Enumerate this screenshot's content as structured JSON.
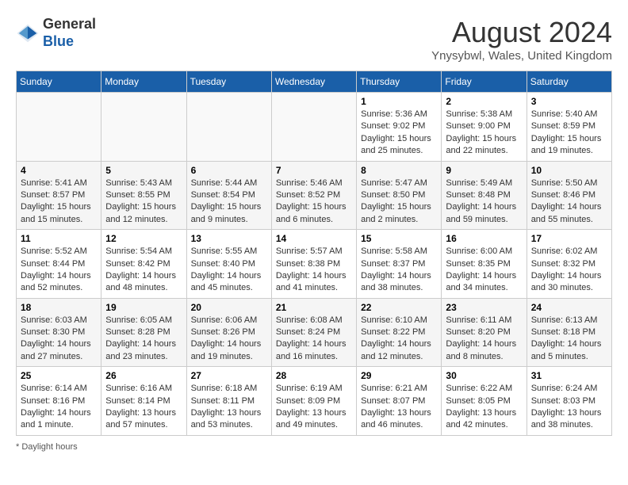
{
  "logo": {
    "text_general": "General",
    "text_blue": "Blue"
  },
  "title": "August 2024",
  "location": "Ynysybwl, Wales, United Kingdom",
  "days_of_week": [
    "Sunday",
    "Monday",
    "Tuesday",
    "Wednesday",
    "Thursday",
    "Friday",
    "Saturday"
  ],
  "footer": "Daylight hours",
  "weeks": [
    [
      {
        "day": "",
        "info": ""
      },
      {
        "day": "",
        "info": ""
      },
      {
        "day": "",
        "info": ""
      },
      {
        "day": "",
        "info": ""
      },
      {
        "day": "1",
        "info": "Sunrise: 5:36 AM\nSunset: 9:02 PM\nDaylight: 15 hours\nand 25 minutes."
      },
      {
        "day": "2",
        "info": "Sunrise: 5:38 AM\nSunset: 9:00 PM\nDaylight: 15 hours\nand 22 minutes."
      },
      {
        "day": "3",
        "info": "Sunrise: 5:40 AM\nSunset: 8:59 PM\nDaylight: 15 hours\nand 19 minutes."
      }
    ],
    [
      {
        "day": "4",
        "info": "Sunrise: 5:41 AM\nSunset: 8:57 PM\nDaylight: 15 hours\nand 15 minutes."
      },
      {
        "day": "5",
        "info": "Sunrise: 5:43 AM\nSunset: 8:55 PM\nDaylight: 15 hours\nand 12 minutes."
      },
      {
        "day": "6",
        "info": "Sunrise: 5:44 AM\nSunset: 8:54 PM\nDaylight: 15 hours\nand 9 minutes."
      },
      {
        "day": "7",
        "info": "Sunrise: 5:46 AM\nSunset: 8:52 PM\nDaylight: 15 hours\nand 6 minutes."
      },
      {
        "day": "8",
        "info": "Sunrise: 5:47 AM\nSunset: 8:50 PM\nDaylight: 15 hours\nand 2 minutes."
      },
      {
        "day": "9",
        "info": "Sunrise: 5:49 AM\nSunset: 8:48 PM\nDaylight: 14 hours\nand 59 minutes."
      },
      {
        "day": "10",
        "info": "Sunrise: 5:50 AM\nSunset: 8:46 PM\nDaylight: 14 hours\nand 55 minutes."
      }
    ],
    [
      {
        "day": "11",
        "info": "Sunrise: 5:52 AM\nSunset: 8:44 PM\nDaylight: 14 hours\nand 52 minutes."
      },
      {
        "day": "12",
        "info": "Sunrise: 5:54 AM\nSunset: 8:42 PM\nDaylight: 14 hours\nand 48 minutes."
      },
      {
        "day": "13",
        "info": "Sunrise: 5:55 AM\nSunset: 8:40 PM\nDaylight: 14 hours\nand 45 minutes."
      },
      {
        "day": "14",
        "info": "Sunrise: 5:57 AM\nSunset: 8:38 PM\nDaylight: 14 hours\nand 41 minutes."
      },
      {
        "day": "15",
        "info": "Sunrise: 5:58 AM\nSunset: 8:37 PM\nDaylight: 14 hours\nand 38 minutes."
      },
      {
        "day": "16",
        "info": "Sunrise: 6:00 AM\nSunset: 8:35 PM\nDaylight: 14 hours\nand 34 minutes."
      },
      {
        "day": "17",
        "info": "Sunrise: 6:02 AM\nSunset: 8:32 PM\nDaylight: 14 hours\nand 30 minutes."
      }
    ],
    [
      {
        "day": "18",
        "info": "Sunrise: 6:03 AM\nSunset: 8:30 PM\nDaylight: 14 hours\nand 27 minutes."
      },
      {
        "day": "19",
        "info": "Sunrise: 6:05 AM\nSunset: 8:28 PM\nDaylight: 14 hours\nand 23 minutes."
      },
      {
        "day": "20",
        "info": "Sunrise: 6:06 AM\nSunset: 8:26 PM\nDaylight: 14 hours\nand 19 minutes."
      },
      {
        "day": "21",
        "info": "Sunrise: 6:08 AM\nSunset: 8:24 PM\nDaylight: 14 hours\nand 16 minutes."
      },
      {
        "day": "22",
        "info": "Sunrise: 6:10 AM\nSunset: 8:22 PM\nDaylight: 14 hours\nand 12 minutes."
      },
      {
        "day": "23",
        "info": "Sunrise: 6:11 AM\nSunset: 8:20 PM\nDaylight: 14 hours\nand 8 minutes."
      },
      {
        "day": "24",
        "info": "Sunrise: 6:13 AM\nSunset: 8:18 PM\nDaylight: 14 hours\nand 5 minutes."
      }
    ],
    [
      {
        "day": "25",
        "info": "Sunrise: 6:14 AM\nSunset: 8:16 PM\nDaylight: 14 hours\nand 1 minute."
      },
      {
        "day": "26",
        "info": "Sunrise: 6:16 AM\nSunset: 8:14 PM\nDaylight: 13 hours\nand 57 minutes."
      },
      {
        "day": "27",
        "info": "Sunrise: 6:18 AM\nSunset: 8:11 PM\nDaylight: 13 hours\nand 53 minutes."
      },
      {
        "day": "28",
        "info": "Sunrise: 6:19 AM\nSunset: 8:09 PM\nDaylight: 13 hours\nand 49 minutes."
      },
      {
        "day": "29",
        "info": "Sunrise: 6:21 AM\nSunset: 8:07 PM\nDaylight: 13 hours\nand 46 minutes."
      },
      {
        "day": "30",
        "info": "Sunrise: 6:22 AM\nSunset: 8:05 PM\nDaylight: 13 hours\nand 42 minutes."
      },
      {
        "day": "31",
        "info": "Sunrise: 6:24 AM\nSunset: 8:03 PM\nDaylight: 13 hours\nand 38 minutes."
      }
    ]
  ]
}
